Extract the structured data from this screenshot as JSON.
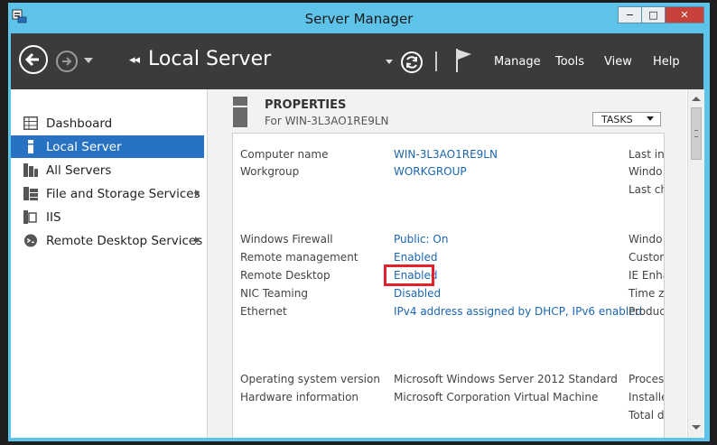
{
  "window": {
    "title": "Server Manager",
    "minimize": "−",
    "maximize": "□",
    "close": "✕"
  },
  "header": {
    "breadcrumb_arrows": "◂◂",
    "page_title": "Local Server",
    "menus": [
      "Manage",
      "Tools",
      "View",
      "Help"
    ]
  },
  "sidebar": {
    "items": [
      {
        "label": "Dashboard",
        "icon": "dashboard-icon",
        "active": false,
        "has_submenu": false
      },
      {
        "label": "Local Server",
        "icon": "local-server-icon",
        "active": true,
        "has_submenu": false
      },
      {
        "label": "All Servers",
        "icon": "all-servers-icon",
        "active": false,
        "has_submenu": false
      },
      {
        "label": "File and Storage Services",
        "icon": "file-storage-icon",
        "active": false,
        "has_submenu": true
      },
      {
        "label": "IIS",
        "icon": "iis-icon",
        "active": false,
        "has_submenu": false
      },
      {
        "label": "Remote Desktop Services",
        "icon": "remote-desktop-icon",
        "active": false,
        "has_submenu": true
      }
    ]
  },
  "properties": {
    "title": "PROPERTIES",
    "subtitle": "For WIN-3L3AO1RE9LN",
    "tasks_label": "TASKS",
    "rows": [
      {
        "label": "Computer name",
        "value": "WIN-3L3AO1RE9LN",
        "link": true
      },
      {
        "label": "Workgroup",
        "value": "WORKGROUP",
        "link": true
      },
      {
        "label": "Windows Firewall",
        "value": "Public: On",
        "link": true
      },
      {
        "label": "Remote management",
        "value": "Enabled",
        "link": true
      },
      {
        "label": "Remote Desktop",
        "value": "Enabled",
        "link": true
      },
      {
        "label": "NIC Teaming",
        "value": "Disabled",
        "link": true
      },
      {
        "label": "Ethernet",
        "value": "IPv4 address assigned by DHCP, IPv6 enabled",
        "link": true
      },
      {
        "label": "Operating system version",
        "value": "Microsoft Windows Server 2012 Standard",
        "link": false
      },
      {
        "label": "Hardware information",
        "value": "Microsoft Corporation Virtual Machine",
        "link": false
      }
    ],
    "right_column": [
      "Last ins",
      "Windo",
      "Last ch",
      "Windo",
      "Custom",
      "IE Enha",
      "Time zo",
      "Produc",
      "Process",
      "Installe",
      "Total d"
    ]
  },
  "colors": {
    "accent": "#2772c3",
    "link": "#1a66b0",
    "frame": "#5ec3e8",
    "header": "#3b3b3b",
    "highlight": "#e3202c"
  }
}
